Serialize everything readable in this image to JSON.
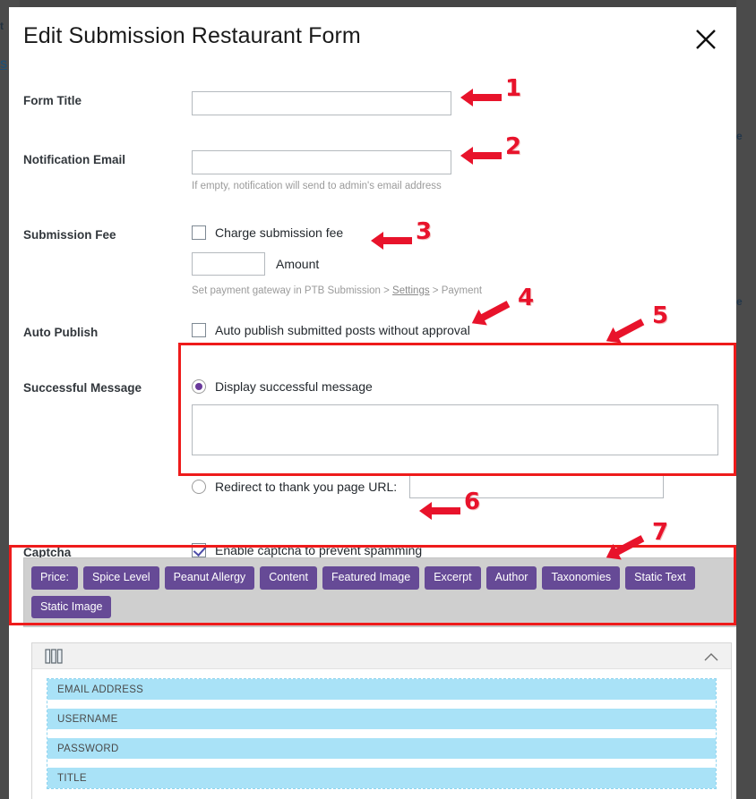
{
  "background": {
    "left_fragments": [
      "t",
      "S"
    ],
    "right_fragments": [
      "e",
      "e"
    ]
  },
  "modal": {
    "title": "Edit Submission Restaurant Form",
    "close_label": "×"
  },
  "form": {
    "rows": [
      {
        "label": "Form Title",
        "value": "",
        "placeholder": ""
      },
      {
        "label": "Notification Email",
        "value": "",
        "placeholder": "",
        "hint": "If empty, notification will send to admin's email address"
      },
      {
        "label": "Submission Fee"
      },
      {
        "label": "Auto Publish"
      },
      {
        "label": "Successful Message"
      },
      {
        "label": "Captcha"
      }
    ],
    "submission_fee": {
      "checkbox_label": "Charge submission fee",
      "checked": false,
      "amount_value": "",
      "amount_label": "Amount",
      "hint_prefix": "Set payment gateway in PTB Submission > ",
      "hint_link": "Settings",
      "hint_suffix": " > Payment"
    },
    "auto_publish": {
      "checkbox_label": "Auto publish submitted posts without approval",
      "checked": false
    },
    "successful_message": {
      "radio_display_label": "Display successful message",
      "radio_display_selected": true,
      "message_value": "",
      "radio_redirect_label": "Redirect to thank you page URL:",
      "radio_redirect_selected": false,
      "redirect_value": ""
    },
    "captcha": {
      "checkbox_label": "Enable captcha to prevent spamming",
      "checked": true
    }
  },
  "builder": {
    "buttons": [
      "Price:",
      "Spice Level",
      "Peanut Allergy",
      "Content",
      "Featured Image",
      "Excerpt",
      "Author",
      "Taxonomies",
      "Static Text",
      "Static Image"
    ]
  },
  "panel": {
    "columns_icon": "columns-icon",
    "collapse_icon": "chevron-up-icon",
    "fields": [
      "EMAIL ADDRESS",
      "USERNAME",
      "PASSWORD",
      "TITLE"
    ]
  },
  "annotations": {
    "numbers": [
      "1",
      "2",
      "3",
      "4",
      "5",
      "6",
      "7"
    ],
    "color": "#e8132b"
  },
  "colors": {
    "accent_purple": "#664a96",
    "radio_purple": "#6a3a9b",
    "field_blue": "#a9e2f7",
    "annotation_red": "#ee1b1b",
    "toolbar_gray": "#cfcfcf"
  }
}
